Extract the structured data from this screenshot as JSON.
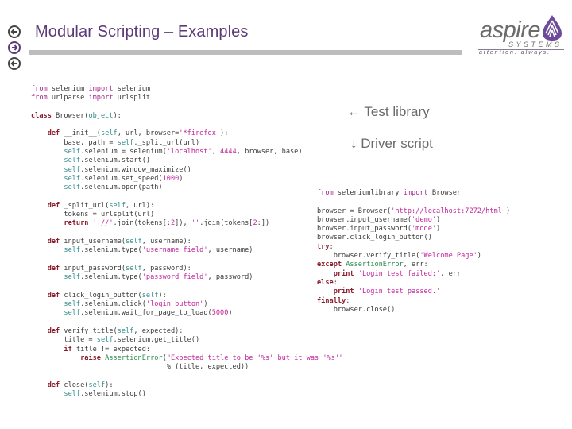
{
  "slide": {
    "title": "Modular Scripting – Examples",
    "nav_icons": [
      "back-arrow-icon",
      "forward-arrow-icon",
      "back-arrow-icon"
    ],
    "accent_color": "#5b3a78"
  },
  "logo": {
    "wordmark": "aspire",
    "subtitle": "SYSTEMS",
    "tagline": "attention. always."
  },
  "annotations": {
    "test_library": "← Test library",
    "driver_script": "↓ Driver script"
  },
  "test_library_code": [
    "from selenium import selenium",
    "from urlparse import urlsplit",
    "",
    "class Browser(object):",
    "",
    "    def __init__(self, url, browser='*firefox'):",
    "        base, path = self._split_url(url)",
    "        self.selenium = selenium('localhost', 4444, browser, base)",
    "        self.selenium.start()",
    "        self.selenium.window_maximize()",
    "        self.selenium.set_speed(1000)",
    "        self.selenium.open(path)",
    "",
    "    def _split_url(self, url):",
    "        tokens = urlsplit(url)",
    "        return '://'.join(tokens[:2]), ''.join(tokens[2:])",
    "",
    "    def input_username(self, username):",
    "        self.selenium.type('username_field', username)",
    "",
    "    def input_password(self, password):",
    "        self.selenium.type('password_field', password)",
    "",
    "    def click_login_button(self):",
    "        self.selenium.click('login_button')",
    "        self.selenium.wait_for_page_to_load(5000)",
    "",
    "    def verify_title(self, expected):",
    "        title = self.selenium.get_title()",
    "        if title != expected:",
    "            raise AssertionError(\"Expected title to be '%s' but it was '%s'\"",
    "                                 % (title, expected))",
    "",
    "    def close(self):",
    "        self.selenium.stop()"
  ],
  "driver_script_code": [
    "from seleniumlibrary import Browser",
    "",
    "browser = Browser('http://localhost:7272/html')",
    "browser.input_username('demo')",
    "browser.input_password('mode')",
    "browser.click_login_button()",
    "try:",
    "    browser.verify_title('Welcome Page')",
    "except AssertionError, err:",
    "    print 'Login test failed:', err",
    "else:",
    "    print 'Login test passed.'",
    "finally:",
    "    browser.close()"
  ]
}
